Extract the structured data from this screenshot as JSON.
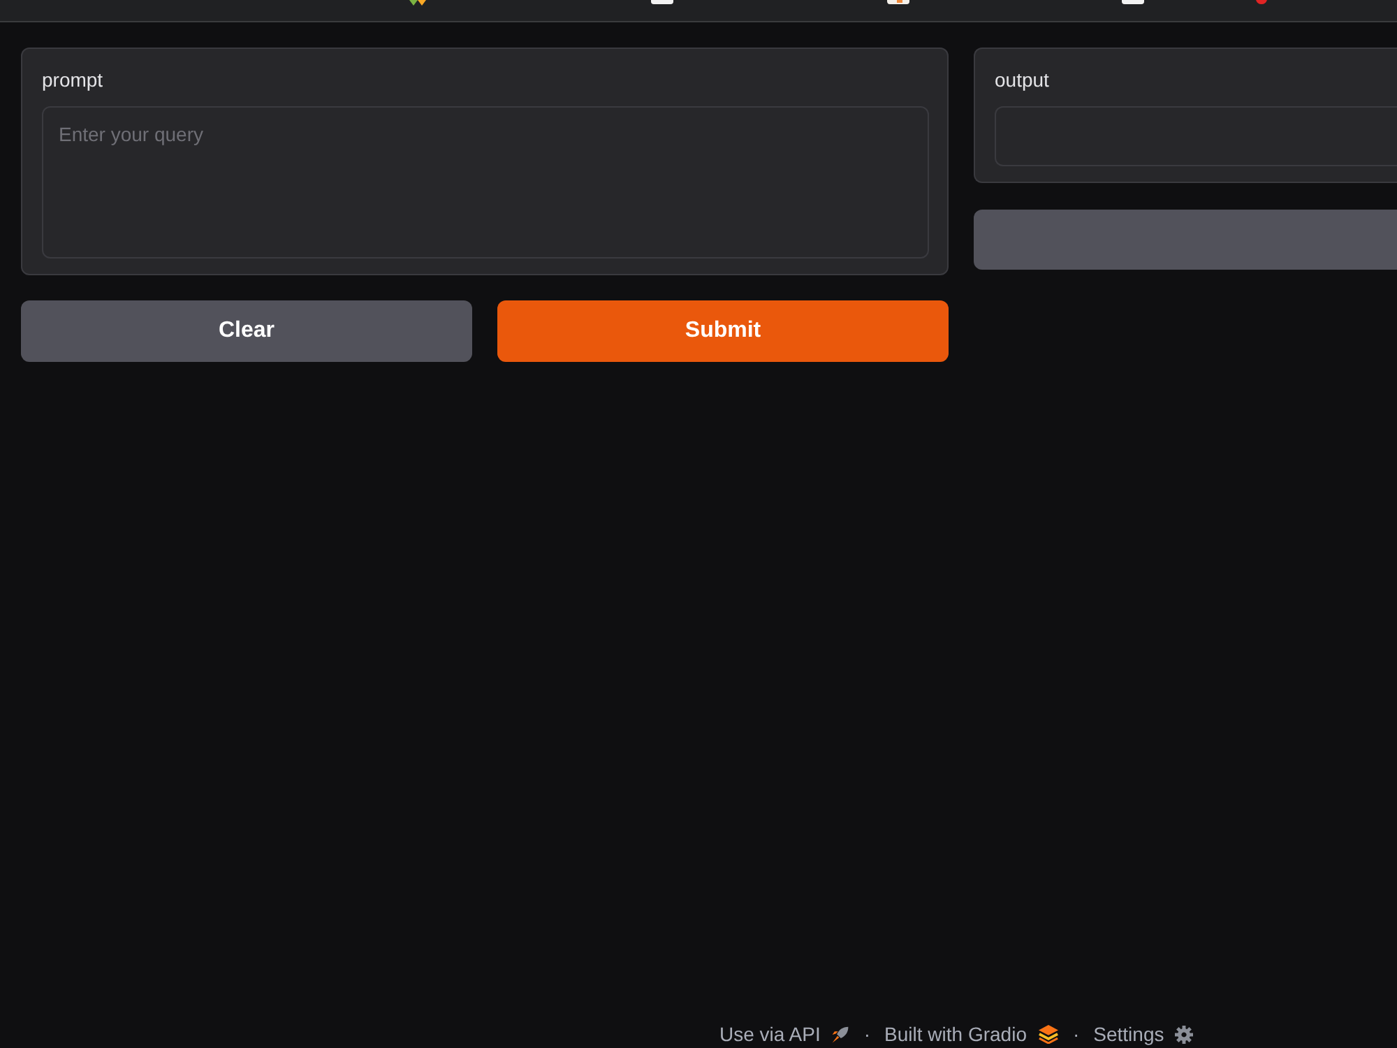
{
  "prompt_panel": {
    "label": "prompt",
    "placeholder": "Enter your query"
  },
  "buttons": [
    {
      "label": "Clear",
      "kind": "secondary"
    },
    {
      "label": "Submit",
      "kind": "primary"
    }
  ],
  "output_panel": {
    "label": "output"
  },
  "output_buttons": [
    {
      "kind": "secondary"
    }
  ],
  "footer": [
    {
      "kind": "link",
      "label": "Use via API"
    },
    {
      "kind": "separator",
      "text": "·"
    },
    {
      "kind": "link",
      "label": "Built with Gradio"
    },
    {
      "kind": "separator",
      "text": "·"
    },
    {
      "kind": "link",
      "label": "Settings"
    }
  ]
}
